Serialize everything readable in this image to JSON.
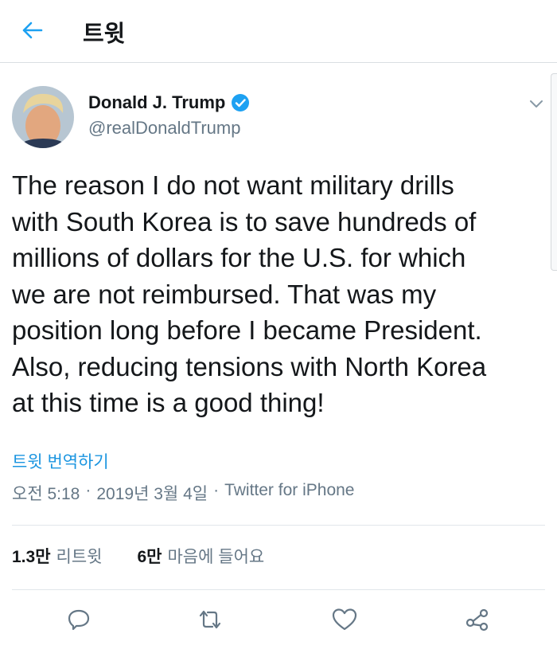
{
  "header": {
    "title": "트윗"
  },
  "tweet": {
    "author": {
      "name": "Donald J. Trump",
      "handle": "@realDonaldTrump"
    },
    "text": "The reason I do not want military drills\nwith South Korea is to save hundreds of\nmillions of dollars for the U.S. for which\nwe are not reimbursed. That was my\nposition long before I became President.\nAlso, reducing tensions with North Korea\nat this time is a good thing!",
    "translate_label": "트윗 번역하기",
    "time": "오전 5:18",
    "date": "2019년 3월 4일",
    "source": "Twitter for iPhone",
    "separator": "·"
  },
  "stats": {
    "retweets": {
      "count": "1.3만",
      "label": "리트윗"
    },
    "likes": {
      "count": "6만",
      "label": "마음에 들어요"
    }
  },
  "icons": {
    "back": "arrow-left-icon",
    "verified": "verified-badge-icon",
    "caret": "chevron-down-icon",
    "reply": "reply-icon",
    "retweet": "retweet-icon",
    "like": "heart-icon",
    "share": "share-icon"
  },
  "colors": {
    "accent": "#1da1f2",
    "link": "#1b95e0",
    "secondary_text": "#657786",
    "icon": "#657786"
  }
}
